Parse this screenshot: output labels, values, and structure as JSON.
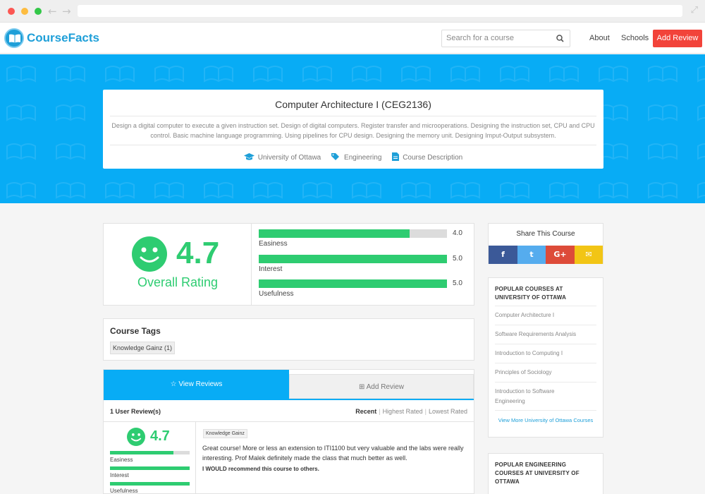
{
  "brand": {
    "name": "CourseFacts"
  },
  "nav": {
    "search_placeholder": "Search for a course",
    "about": "About",
    "schools": "Schools",
    "add_review": "Add Review"
  },
  "course": {
    "title": "Computer Architecture I (CEG2136)",
    "description": "Design a digital computer to execute a given instruction set. Design of digital computers. Register transfer and microoperations. Designing the instruction set, CPU and CPU control. Basic machine language programming. Using pipelines for CPU design. Designing the memory unit. Designing Imput-Output subsystem.",
    "university": "University of Ottawa",
    "faculty": "Engineering",
    "description_link": "Course Description"
  },
  "rating": {
    "overall": "4.7",
    "overall_label": "Overall Rating",
    "metrics": [
      {
        "label": "Easiness",
        "value": "4.0",
        "fraction": 0.8
      },
      {
        "label": "Interest",
        "value": "5.0",
        "fraction": 1.0
      },
      {
        "label": "Usefulness",
        "value": "5.0",
        "fraction": 1.0
      }
    ]
  },
  "tags": {
    "title": "Course Tags",
    "items": [
      "Knowledge Gainz (1)"
    ]
  },
  "reviews": {
    "tab_view": "View Reviews",
    "tab_add": "Add Review",
    "count": "1 User Review(s)",
    "sort": {
      "recent": "Recent",
      "highest": "Highest Rated",
      "lowest": "Lowest Rated"
    },
    "items": [
      {
        "score": "4.7",
        "metrics": [
          {
            "label": "Easiness",
            "fraction": 0.8
          },
          {
            "label": "Interest",
            "fraction": 1.0
          },
          {
            "label": "Usefulness",
            "fraction": 1.0
          }
        ],
        "tag": "Knowledge Gainz",
        "text": "Great course! More or less an extension to ITI1100 but very valuable and the labs were really interesting. Prof Malek definitely made the class that much better as well.",
        "recommend": "I WOULD recommend this course to others."
      }
    ]
  },
  "share": {
    "title": "Share This Course",
    "facebook": "f",
    "twitter": "t",
    "google": "G+",
    "email": "✉"
  },
  "popular": {
    "title": "POPULAR COURSES AT UNIVERSITY OF OTTAWA",
    "items": [
      "Computer Architecture I",
      "Software Requirements Analysis",
      "Introduction to Computing I",
      "Principles of Sociology",
      "Introduction to Software Engineering"
    ],
    "more": "View More University of Ottawa Courses"
  },
  "popular_eng": {
    "title": "POPULAR ENGINEERING COURSES AT UNIVERSITY OF OTTAWA"
  },
  "colors": {
    "accent": "#08acf5",
    "green": "#2ecc71",
    "red": "#f2433a"
  }
}
